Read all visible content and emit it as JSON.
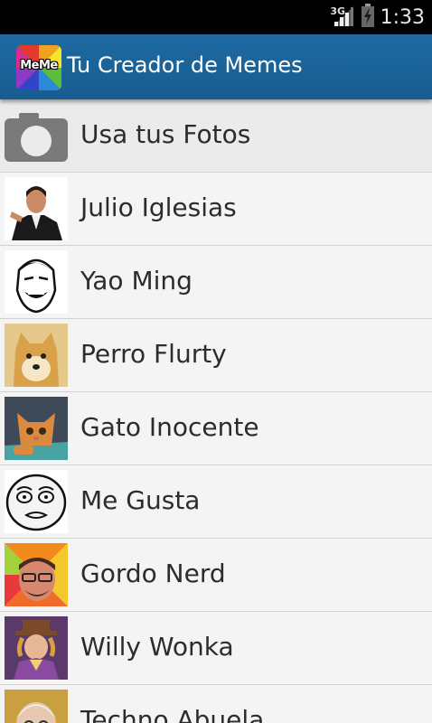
{
  "status_bar": {
    "network_type": "3G",
    "time": "1:33"
  },
  "action_bar": {
    "logo_text": "MeMe",
    "title": "Tu Creador de Memes"
  },
  "list": {
    "items": [
      {
        "label": "Usa tus Fotos",
        "icon": "camera-icon"
      },
      {
        "label": "Julio Iglesias",
        "icon": "julio-iglesias-thumbnail"
      },
      {
        "label": "Yao Ming",
        "icon": "yao-ming-thumbnail"
      },
      {
        "label": "Perro Flurty",
        "icon": "doge-thumbnail"
      },
      {
        "label": "Gato Inocente",
        "icon": "cat-thumbnail"
      },
      {
        "label": "Me Gusta",
        "icon": "me-gusta-thumbnail"
      },
      {
        "label": "Gordo Nerd",
        "icon": "gordo-nerd-thumbnail"
      },
      {
        "label": "Willy Wonka",
        "icon": "willy-wonka-thumbnail"
      },
      {
        "label": "Techno Abuela",
        "icon": "techno-abuela-thumbnail"
      }
    ]
  },
  "colors": {
    "action_bar": "#1b649a",
    "status_bar": "#000000",
    "list_background": "#f4f4f4",
    "divider": "#d2d2d2",
    "text": "#2c2c2c"
  }
}
